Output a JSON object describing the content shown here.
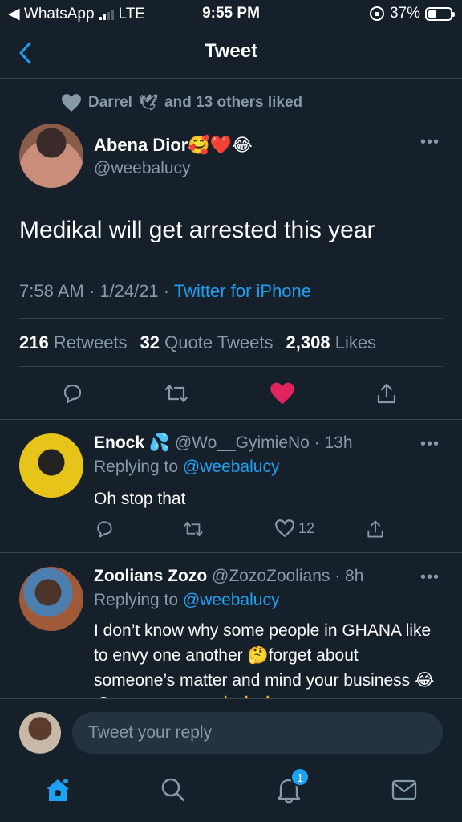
{
  "status_bar": {
    "back_app": "◀ WhatsApp",
    "network": "LTE",
    "time": "9:55 PM",
    "battery": "37%",
    "battery_level": 0.37
  },
  "nav": {
    "title": "Tweet"
  },
  "liked_by": {
    "name": "Darrel",
    "emoji": "🕊",
    "rest": "and 13 others liked"
  },
  "main_tweet": {
    "author_name": "Abena Dior🥰❤️😂",
    "handle": "@weebalucy",
    "text": "Medikal will get arrested this year",
    "time_date": "7:58 AM · 1/24/21 · ",
    "source": "Twitter for iPhone",
    "stats": {
      "retweets_count": "216",
      "retweets_label": "Retweets",
      "quotes_count": "32",
      "quotes_label": "Quote Tweets",
      "likes_count": "2,308",
      "likes_label": "Likes"
    }
  },
  "replies": [
    {
      "name": " Enock 💦",
      "handle_time": "@Wo__GyimieNo · 13h",
      "replying_prefix": "Replying to ",
      "replying_to": "@weebalucy",
      "text": "Oh stop that",
      "like_count": "12"
    },
    {
      "name": "Zoolians Zozo",
      "handle_time": "@ZozoZoolians · 8h",
      "replying_prefix": "Replying to ",
      "replying_to": "@weebalucy",
      "text": "I don’t know why some people in GHANA like to envy one another 🤔forget about someone’s matter and mind your business 😂😂a full like you 🖕🖕🖕"
    }
  ],
  "compose": {
    "placeholder": "Tweet your reply"
  },
  "tab_bar": {
    "notification_badge": "1"
  },
  "colors": {
    "background": "#15202b",
    "accent": "#1da1f2",
    "like": "#e0245e",
    "muted": "#8899a6",
    "divider": "#38444d"
  }
}
